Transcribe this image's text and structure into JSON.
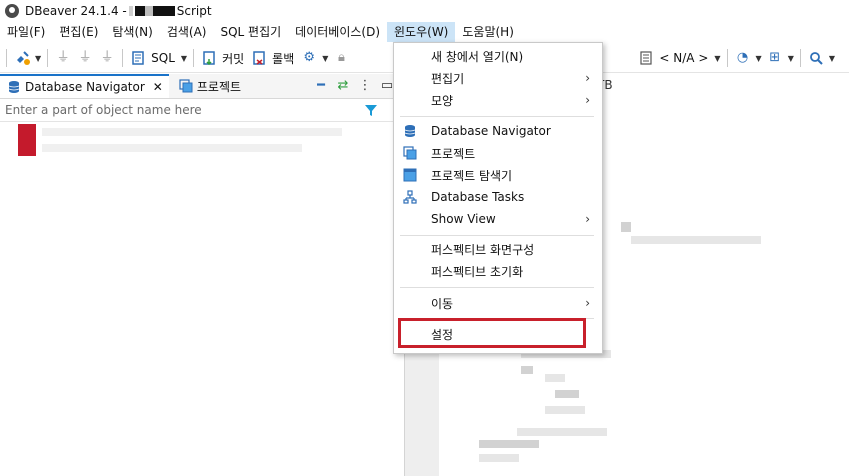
{
  "window": {
    "title_prefix": "DBeaver 24.1.4 - ",
    "title_suffix": " Script"
  },
  "menubar": [
    {
      "label": "파일(F)"
    },
    {
      "label": "편집(E)"
    },
    {
      "label": "탐색(N)"
    },
    {
      "label": "검색(A)"
    },
    {
      "label": "SQL 편집기"
    },
    {
      "label": "데이터베이스(D)"
    },
    {
      "label": "윈도우(W)"
    },
    {
      "label": "도움말(H)"
    }
  ],
  "toolbar": {
    "sql_label": "SQL",
    "commit_label": "커밋",
    "rollback_label": "롤백",
    "na_label": "< N/A >"
  },
  "left_panel": {
    "tab_navigator": "Database Navigator",
    "tab_projects": "프로젝트",
    "filter_placeholder": "Enter a part of object name here"
  },
  "right_panel": {
    "tab_fragment": "TB"
  },
  "dropdown": {
    "items": [
      {
        "label": "새 창에서 열기(N)",
        "icon": "",
        "submenu": false
      },
      {
        "label": "편집기",
        "icon": "",
        "submenu": true
      },
      {
        "label": "모양",
        "icon": "",
        "submenu": true
      },
      {
        "label": "Database Navigator",
        "icon": "database-navigator-icon",
        "submenu": false
      },
      {
        "label": "프로젝트",
        "icon": "projects-icon",
        "submenu": false
      },
      {
        "label": "프로젝트 탐색기",
        "icon": "project-explorer-icon",
        "submenu": false
      },
      {
        "label": "Database Tasks",
        "icon": "database-tasks-icon",
        "submenu": false
      },
      {
        "label": "Show View",
        "icon": "",
        "submenu": true
      },
      {
        "label": "퍼스펙티브 화면구성",
        "icon": "",
        "submenu": false
      },
      {
        "label": "퍼스펙티브 초기화",
        "icon": "",
        "submenu": false
      },
      {
        "label": "이동",
        "icon": "",
        "submenu": true
      },
      {
        "label": "설정",
        "icon": "",
        "submenu": false
      }
    ],
    "submenu_glyph": "›"
  },
  "colors": {
    "highlight": "#c8202b",
    "tab_accent": "#1a73c9",
    "menu_active": "#cce4f7"
  }
}
